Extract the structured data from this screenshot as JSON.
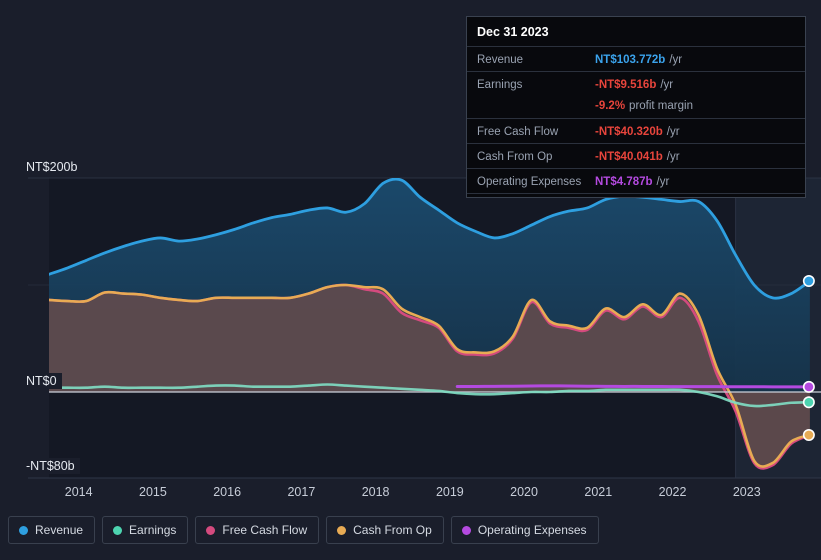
{
  "axes": {
    "y_labels": [
      {
        "text": "NT$200b",
        "value": 200
      },
      {
        "text": "NT$0",
        "value": 0
      },
      {
        "text": "-NT$80b",
        "value": -80
      }
    ],
    "x_labels": [
      "2014",
      "2015",
      "2016",
      "2017",
      "2018",
      "2019",
      "2020",
      "2021",
      "2022",
      "2023"
    ]
  },
  "tooltip": {
    "date": "Dec 31 2023",
    "rows": [
      {
        "key": "Revenue",
        "value": "NT$103.772b",
        "unit": "/yr",
        "color": "#3ba3ec"
      },
      {
        "key": "Earnings",
        "value": "-NT$9.516b",
        "unit": "/yr",
        "color": "#e8453c"
      },
      {
        "key": "",
        "value": "-9.2%",
        "unit": "profit margin",
        "color": "#e8453c",
        "sub": true
      },
      {
        "key": "Free Cash Flow",
        "value": "-NT$40.320b",
        "unit": "/yr",
        "color": "#e8453c"
      },
      {
        "key": "Cash From Op",
        "value": "-NT$40.041b",
        "unit": "/yr",
        "color": "#e8453c"
      },
      {
        "key": "Operating Expenses",
        "value": "NT$4.787b",
        "unit": "/yr",
        "color": "#b44ae0"
      }
    ]
  },
  "legend": [
    {
      "label": "Revenue",
      "color": "#2e9fe0"
    },
    {
      "label": "Earnings",
      "color": "#4dd4b0"
    },
    {
      "label": "Free Cash Flow",
      "color": "#d44a7e"
    },
    {
      "label": "Cash From Op",
      "color": "#e8ab54"
    },
    {
      "label": "Operating Expenses",
      "color": "#b44ae0"
    }
  ],
  "colors": {
    "background": "#1a1e2b",
    "plot_background": "#141824",
    "gridline": "#2e3647",
    "zero_line": "#c9ced8",
    "revenue_line": "#2e9fe0",
    "revenue_fill": "#16374f",
    "earnings_line": "#7fdcc2",
    "fcf_line": "#d44a7e",
    "fcf_fill": "#6b4a50",
    "cfo_line": "#e8ab54",
    "cfo_fill": "#4d4d46",
    "opex_line": "#b44ae0"
  },
  "chart_data": {
    "type": "area",
    "title": "",
    "xlabel": "",
    "ylabel": "NT$ (billions)",
    "ylim": [
      -80,
      200
    ],
    "xlim": [
      2013.6,
      2024.0
    ],
    "grid": true,
    "legend_position": "bottom",
    "currency": "NT$",
    "unit": "b",
    "x": [
      2013.6,
      2013.85,
      2014.1,
      2014.35,
      2014.6,
      2014.85,
      2015.1,
      2015.35,
      2015.6,
      2015.85,
      2016.1,
      2016.35,
      2016.6,
      2016.85,
      2017.1,
      2017.35,
      2017.6,
      2017.85,
      2018.1,
      2018.35,
      2018.6,
      2018.85,
      2019.1,
      2019.35,
      2019.6,
      2019.85,
      2020.1,
      2020.35,
      2020.6,
      2020.85,
      2021.1,
      2021.35,
      2021.6,
      2021.85,
      2022.1,
      2022.35,
      2022.6,
      2022.85,
      2023.1,
      2023.35,
      2023.6,
      2023.85
    ],
    "series": [
      {
        "name": "Revenue",
        "color": "#2e9fe0",
        "values": [
          110,
          116,
          123,
          130,
          136,
          141,
          144,
          141,
          143,
          147,
          152,
          158,
          163,
          166,
          170,
          172,
          168,
          176,
          195,
          198,
          182,
          170,
          158,
          150,
          144,
          148,
          156,
          164,
          169,
          172,
          180,
          183,
          182,
          180,
          178,
          178,
          160,
          128,
          100,
          88,
          92,
          103.772
        ]
      },
      {
        "name": "Cash From Op",
        "color": "#e8ab54",
        "values": [
          86,
          85,
          85,
          93,
          92,
          91,
          88,
          86,
          85,
          88,
          88,
          88,
          88,
          88,
          92,
          98,
          100,
          98,
          96,
          78,
          70,
          62,
          40,
          37,
          38,
          52,
          86,
          66,
          62,
          60,
          78,
          70,
          82,
          72,
          92,
          72,
          22,
          -12,
          -64,
          -66,
          -46,
          -40.041
        ]
      },
      {
        "name": "Free Cash Flow",
        "color": "#d44a7e",
        "values": [
          86,
          85,
          85,
          93,
          92,
          91,
          88,
          86,
          85,
          88,
          88,
          88,
          88,
          88,
          92,
          98,
          100,
          96,
          92,
          74,
          67,
          60,
          38,
          35,
          36,
          50,
          84,
          64,
          60,
          58,
          76,
          68,
          80,
          70,
          88,
          66,
          16,
          -18,
          -66,
          -68,
          -48,
          -40.32
        ]
      },
      {
        "name": "Earnings",
        "color": "#7fdcc2",
        "values": [
          4,
          4,
          4,
          5,
          4,
          4,
          4,
          4,
          5,
          6,
          6,
          5,
          5,
          5,
          6,
          7,
          6,
          5,
          4,
          3,
          2,
          1,
          -1,
          -2,
          -2,
          -1,
          0,
          0,
          1,
          1,
          2,
          2,
          2,
          2,
          2,
          0,
          -4,
          -10,
          -13,
          -12,
          -10,
          -9.516
        ]
      },
      {
        "name": "Operating Expenses",
        "color": "#b44ae0",
        "values": [
          null,
          null,
          null,
          null,
          null,
          null,
          null,
          null,
          null,
          null,
          null,
          null,
          null,
          null,
          null,
          null,
          null,
          null,
          null,
          null,
          null,
          null,
          5.2,
          5.2,
          5.3,
          5.4,
          5.6,
          5.7,
          5.6,
          5.4,
          5.3,
          5.2,
          5.2,
          5.1,
          5.0,
          5.0,
          5.0,
          4.9,
          4.9,
          4.8,
          4.8,
          4.787
        ]
      }
    ],
    "endpoints": [
      {
        "name": "Revenue",
        "value": 103.772,
        "color": "#2e9fe0"
      },
      {
        "name": "Operating Expenses",
        "value": 4.787,
        "color": "#b44ae0"
      },
      {
        "name": "Earnings",
        "value": -9.516,
        "color": "#4dd4b0"
      },
      {
        "name": "Cash From Op",
        "value": -40.041,
        "color": "#e8ab54"
      }
    ],
    "highlight_band": {
      "from": 2022.85,
      "to": 2024.0
    }
  }
}
